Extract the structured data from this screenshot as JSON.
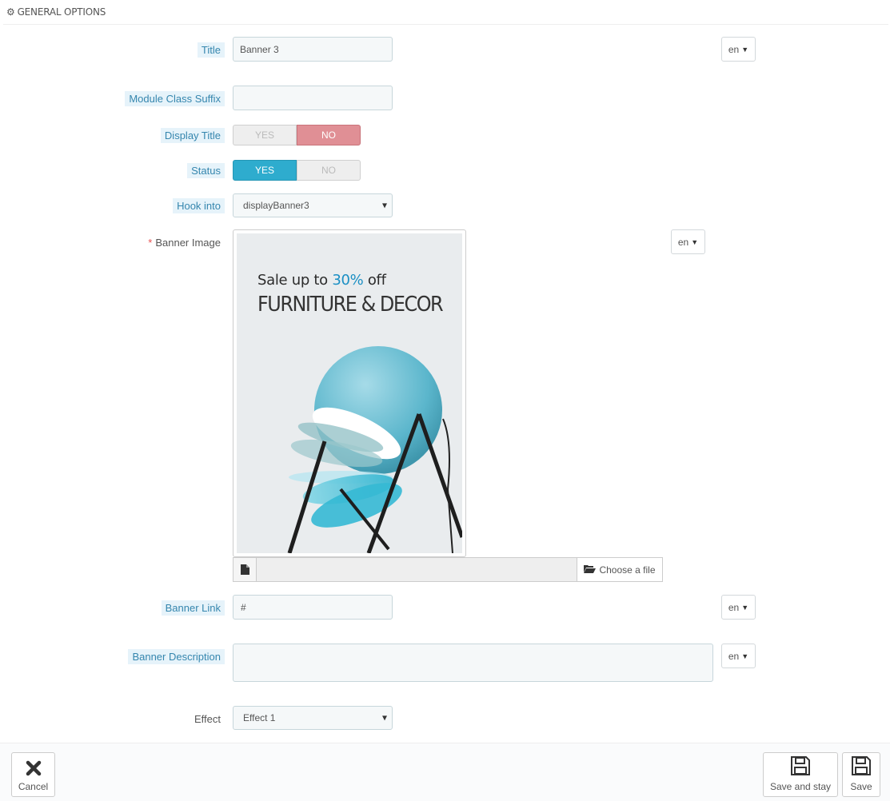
{
  "panel": {
    "heading": "GENERAL OPTIONS",
    "icon": "gears-icon"
  },
  "fields": {
    "title": {
      "label": "Title",
      "value": "Banner 3",
      "lang": "en"
    },
    "module_class_suffix": {
      "label": "Module Class Suffix",
      "value": ""
    },
    "display_title": {
      "label": "Display Title",
      "yes": "YES",
      "no": "NO",
      "selected": "NO"
    },
    "status": {
      "label": "Status",
      "yes": "YES",
      "no": "NO",
      "selected": "YES"
    },
    "hook_into": {
      "label": "Hook into",
      "value": "displayBanner3"
    },
    "banner_image": {
      "label": "Banner Image",
      "required_mark": "*",
      "lang": "en",
      "image_text_line1_prefix": "Sale up to ",
      "image_text_line1_highlight": "30%",
      "image_text_line1_suffix": " off",
      "image_text_line2": "FURNITURE & DECOR",
      "choose_file_label": "Choose a file"
    },
    "banner_link": {
      "label": "Banner Link",
      "value": "#",
      "lang": "en"
    },
    "banner_description": {
      "label": "Banner Description",
      "value": "",
      "lang": "en"
    },
    "effect": {
      "label": "Effect",
      "value": "Effect 1"
    }
  },
  "footer": {
    "cancel": "Cancel",
    "save_and_stay": "Save and stay",
    "save": "Save"
  },
  "colors": {
    "accent": "#2eacce",
    "no_active": "#e08f95",
    "highlight_text": "#1a8fc4"
  }
}
